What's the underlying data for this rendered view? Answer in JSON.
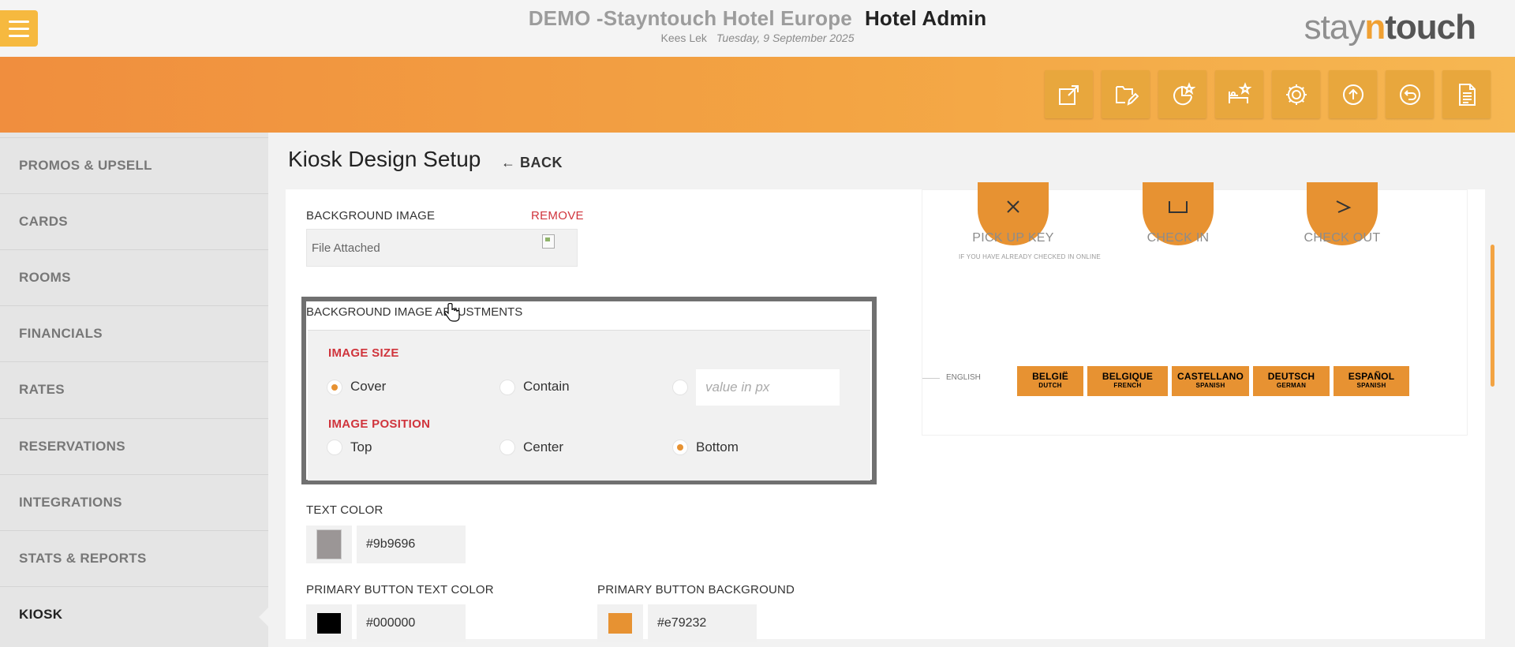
{
  "header": {
    "hotel_name": "DEMO -Stayntouch Hotel Europe",
    "section": "Hotel Admin",
    "user": "Kees Lek",
    "date": "Tuesday, 9 September 2025",
    "logo": {
      "stay": "stay",
      "n": "n",
      "touch": "touch"
    }
  },
  "toolbar": {
    "icons": [
      "export-icon",
      "edit-folder-icon",
      "chart-star-icon",
      "bed-star-icon",
      "settings-icon",
      "upload-icon",
      "undo-icon",
      "document-icon"
    ]
  },
  "sidebar": {
    "items": [
      {
        "label": "PROMOS & UPSELL"
      },
      {
        "label": "CARDS"
      },
      {
        "label": "ROOMS"
      },
      {
        "label": "FINANCIALS"
      },
      {
        "label": "RATES"
      },
      {
        "label": "RESERVATIONS"
      },
      {
        "label": "INTEGRATIONS"
      },
      {
        "label": "STATS & REPORTS"
      },
      {
        "label": "KIOSK"
      }
    ],
    "active": "KIOSK"
  },
  "page": {
    "title": "Kiosk Design Setup",
    "back_label": "BACK"
  },
  "form": {
    "background_image": {
      "label": "BACKGROUND IMAGE",
      "remove_label": "REMOVE",
      "file_text": "File Attached"
    },
    "adjustments": {
      "title": "BACKGROUND IMAGE ADJUSTMENTS",
      "image_size": {
        "heading": "IMAGE SIZE",
        "options": [
          "Cover",
          "Contain"
        ],
        "selected": "Cover",
        "px_placeholder": "value in px"
      },
      "image_position": {
        "heading": "IMAGE POSITION",
        "options": [
          "Top",
          "Center",
          "Bottom"
        ],
        "selected": "Bottom"
      }
    },
    "text_color": {
      "label": "TEXT COLOR",
      "value": "#9b9696"
    },
    "primary_button_text_color": {
      "label": "PRIMARY BUTTON TEXT COLOR",
      "value": "#000000"
    },
    "primary_button_background": {
      "label": "PRIMARY BUTTON BACKGROUND",
      "value": "#e79232"
    }
  },
  "preview": {
    "actions": [
      {
        "label": "PICK UP KEY",
        "sub": "IF YOU HAVE ALREADY CHECKED IN ONLINE"
      },
      {
        "label": "CHECK IN"
      },
      {
        "label": "CHECK OUT"
      }
    ],
    "current_language": "ENGLISH",
    "languages": [
      {
        "name": "BELGIË",
        "sub": "DUTCH"
      },
      {
        "name": "BELGIQUE",
        "sub": "FRENCH"
      },
      {
        "name": "CASTELLANO",
        "sub": "SPANISH"
      },
      {
        "name": "DEUTSCH",
        "sub": "GERMAN"
      },
      {
        "name": "ESPAÑOL",
        "sub": "SPANISH"
      }
    ]
  },
  "colors": {
    "accent": "#e79232",
    "alert": "#d0343c",
    "menu_button": "#f6b93f"
  }
}
